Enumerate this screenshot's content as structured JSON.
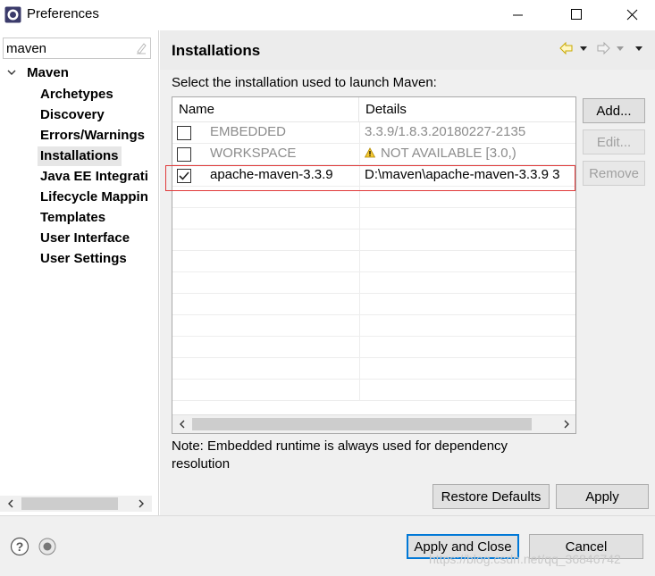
{
  "window": {
    "title": "Preferences"
  },
  "filter": {
    "value": "maven"
  },
  "tree": {
    "root": "Maven",
    "items": [
      "Archetypes",
      "Discovery",
      "Errors/Warnings",
      "Installations",
      "Java EE Integrati",
      "Lifecycle Mappin",
      "Templates",
      "User Interface",
      "User Settings"
    ],
    "selected": "Installations"
  },
  "page": {
    "title": "Installations",
    "instruction": "Select the installation used to launch Maven:",
    "note": "Note: Embedded runtime is always used for dependency resolution"
  },
  "table": {
    "columns": [
      "Name",
      "Details"
    ],
    "rows": [
      {
        "checked": false,
        "name": "EMBEDDED",
        "details": "3.3.9/1.8.3.20180227-2135",
        "warning": false
      },
      {
        "checked": false,
        "name": "WORKSPACE",
        "details": "NOT AVAILABLE [3.0,)",
        "warning": true
      },
      {
        "checked": true,
        "name": "apache-maven-3.3.9",
        "details": "D:\\maven\\apache-maven-3.3.9 3",
        "warning": false
      }
    ]
  },
  "buttons": {
    "add": "Add...",
    "edit": "Edit...",
    "remove": "Remove",
    "restore_defaults": "Restore Defaults",
    "apply": "Apply",
    "apply_and_close": "Apply and Close",
    "cancel": "Cancel"
  },
  "watermark": "https://blog.csdn.net/qq_36846742",
  "colors": {
    "highlight": "#e03a3a",
    "default_button_border": "#0078d7"
  }
}
